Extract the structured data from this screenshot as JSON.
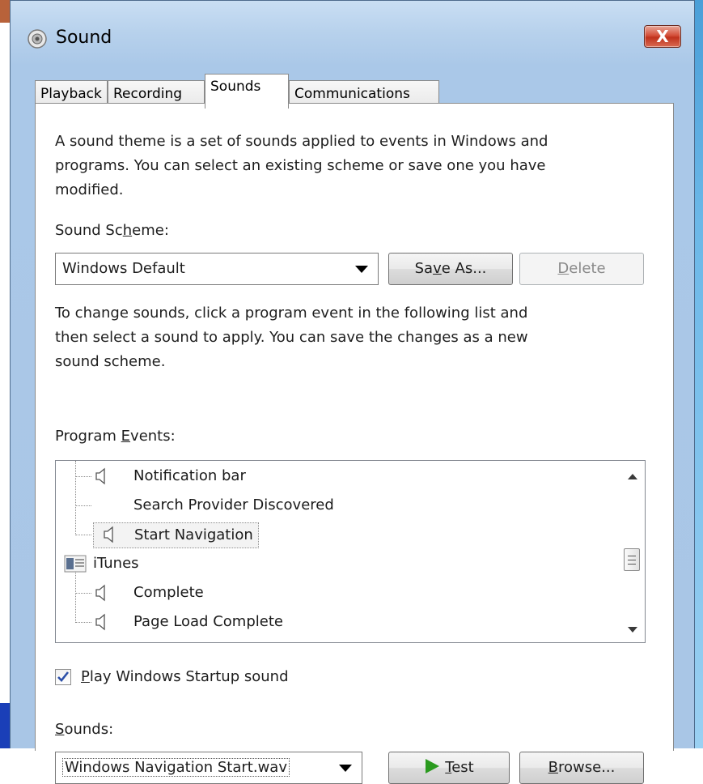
{
  "window": {
    "title": "Sound",
    "close_glyph": "X"
  },
  "tabs": [
    {
      "label": "Playback"
    },
    {
      "label": "Recording"
    },
    {
      "label": "Sounds"
    },
    {
      "label": "Communications"
    }
  ],
  "active_tab": "Sounds",
  "description": {
    "line1": "A sound theme is a set of sounds applied to events in Windows and",
    "line2": "programs.  You can select an existing scheme or save one you have",
    "line3": "modified."
  },
  "scheme": {
    "label_pre": "Sound Sc",
    "label_u": "h",
    "label_post": "eme:",
    "selected": "Windows Default",
    "save_pre": "Sa",
    "save_u": "v",
    "save_post": "e As...",
    "delete_u": "D",
    "delete_post": "elete"
  },
  "instructions": {
    "line1": "To change sounds, click a program event in the following list and",
    "line2": "then select a sound to apply.  You can save the changes as a new",
    "line3": "sound scheme."
  },
  "events": {
    "label_pre": "Program ",
    "label_u": "E",
    "label_post": "vents:",
    "items": [
      {
        "label": "Notification bar",
        "icon": "speaker-icon",
        "level": 1
      },
      {
        "label": "Search Provider Discovered",
        "icon": "none",
        "level": 1
      },
      {
        "label": "Start Navigation",
        "icon": "speaker-icon",
        "level": 1,
        "selected": true
      },
      {
        "label": "iTunes",
        "icon": "app-icon",
        "level": 0
      },
      {
        "label": "Complete",
        "icon": "speaker-icon",
        "level": 1
      },
      {
        "label": "Page Load Complete",
        "icon": "speaker-icon",
        "level": 1
      }
    ]
  },
  "startup": {
    "checked": true,
    "label_u": "P",
    "label_post": "lay Windows Startup sound"
  },
  "sounds": {
    "label_u": "S",
    "label_post": "ounds:",
    "selected": "Windows Navigation Start.wav",
    "test_u": "T",
    "test_post": "est",
    "browse_u": "B",
    "browse_post": "rowse..."
  },
  "colors": {
    "title_gradient_top": "#c9def3",
    "close_button": "#c0321c",
    "desktop_blue": "#1a3fb8",
    "play_green": "#2a9a1e"
  }
}
